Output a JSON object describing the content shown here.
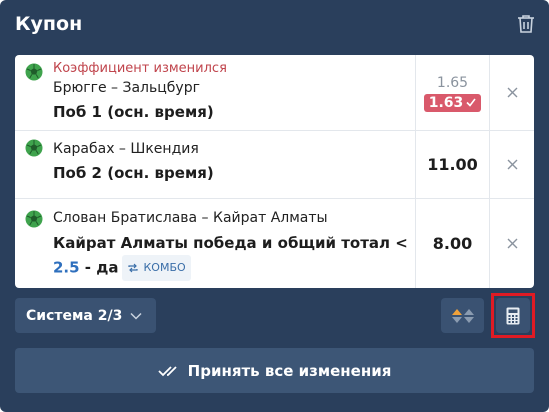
{
  "header": {
    "title": "Купон",
    "trash_icon": "trash-icon"
  },
  "bets": [
    {
      "notice": "Коэффициент изменился",
      "match": "Брюгге – Зальцбург",
      "outcome": "Поб 1 (осн. время)",
      "odd_old": "1.65",
      "odd_new": "1.63",
      "sport_icon": "football-icon"
    },
    {
      "match": "Карабах – Шкендия",
      "outcome": "Поб 2 (осн. время)",
      "odd": "11.00",
      "sport_icon": "football-icon"
    },
    {
      "match": "Слован Братислава – Кайрат Алматы",
      "outcome_before": "Кайрат Алматы победа и общий тотал < ",
      "outcome_highlight": "2.5",
      "outcome_after": " - да",
      "combo_label": "КОМБО",
      "odd": "8.00",
      "sport_icon": "football-icon"
    }
  ],
  "footer": {
    "system_label": "Система 2/3",
    "accept_label": "Принять все изменения"
  },
  "colors": {
    "panel": "#2a3f5c",
    "changed_text": "#c0444c",
    "new_odd_bg": "#d9596b",
    "highlight": "#e01b24"
  }
}
